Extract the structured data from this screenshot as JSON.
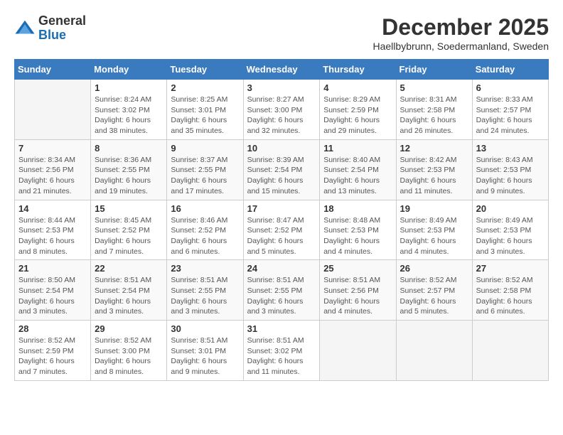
{
  "header": {
    "logo": {
      "general": "General",
      "blue": "Blue"
    },
    "title": "December 2025",
    "location": "Haellbybrunn, Soedermanland, Sweden"
  },
  "calendar": {
    "days_of_week": [
      "Sunday",
      "Monday",
      "Tuesday",
      "Wednesday",
      "Thursday",
      "Friday",
      "Saturday"
    ],
    "weeks": [
      [
        {
          "day": "",
          "detail": ""
        },
        {
          "day": "1",
          "detail": "Sunrise: 8:24 AM\nSunset: 3:02 PM\nDaylight: 6 hours\nand 38 minutes."
        },
        {
          "day": "2",
          "detail": "Sunrise: 8:25 AM\nSunset: 3:01 PM\nDaylight: 6 hours\nand 35 minutes."
        },
        {
          "day": "3",
          "detail": "Sunrise: 8:27 AM\nSunset: 3:00 PM\nDaylight: 6 hours\nand 32 minutes."
        },
        {
          "day": "4",
          "detail": "Sunrise: 8:29 AM\nSunset: 2:59 PM\nDaylight: 6 hours\nand 29 minutes."
        },
        {
          "day": "5",
          "detail": "Sunrise: 8:31 AM\nSunset: 2:58 PM\nDaylight: 6 hours\nand 26 minutes."
        },
        {
          "day": "6",
          "detail": "Sunrise: 8:33 AM\nSunset: 2:57 PM\nDaylight: 6 hours\nand 24 minutes."
        }
      ],
      [
        {
          "day": "7",
          "detail": "Sunrise: 8:34 AM\nSunset: 2:56 PM\nDaylight: 6 hours\nand 21 minutes."
        },
        {
          "day": "8",
          "detail": "Sunrise: 8:36 AM\nSunset: 2:55 PM\nDaylight: 6 hours\nand 19 minutes."
        },
        {
          "day": "9",
          "detail": "Sunrise: 8:37 AM\nSunset: 2:55 PM\nDaylight: 6 hours\nand 17 minutes."
        },
        {
          "day": "10",
          "detail": "Sunrise: 8:39 AM\nSunset: 2:54 PM\nDaylight: 6 hours\nand 15 minutes."
        },
        {
          "day": "11",
          "detail": "Sunrise: 8:40 AM\nSunset: 2:54 PM\nDaylight: 6 hours\nand 13 minutes."
        },
        {
          "day": "12",
          "detail": "Sunrise: 8:42 AM\nSunset: 2:53 PM\nDaylight: 6 hours\nand 11 minutes."
        },
        {
          "day": "13",
          "detail": "Sunrise: 8:43 AM\nSunset: 2:53 PM\nDaylight: 6 hours\nand 9 minutes."
        }
      ],
      [
        {
          "day": "14",
          "detail": "Sunrise: 8:44 AM\nSunset: 2:53 PM\nDaylight: 6 hours\nand 8 minutes."
        },
        {
          "day": "15",
          "detail": "Sunrise: 8:45 AM\nSunset: 2:52 PM\nDaylight: 6 hours\nand 7 minutes."
        },
        {
          "day": "16",
          "detail": "Sunrise: 8:46 AM\nSunset: 2:52 PM\nDaylight: 6 hours\nand 6 minutes."
        },
        {
          "day": "17",
          "detail": "Sunrise: 8:47 AM\nSunset: 2:52 PM\nDaylight: 6 hours\nand 5 minutes."
        },
        {
          "day": "18",
          "detail": "Sunrise: 8:48 AM\nSunset: 2:53 PM\nDaylight: 6 hours\nand 4 minutes."
        },
        {
          "day": "19",
          "detail": "Sunrise: 8:49 AM\nSunset: 2:53 PM\nDaylight: 6 hours\nand 4 minutes."
        },
        {
          "day": "20",
          "detail": "Sunrise: 8:49 AM\nSunset: 2:53 PM\nDaylight: 6 hours\nand 3 minutes."
        }
      ],
      [
        {
          "day": "21",
          "detail": "Sunrise: 8:50 AM\nSunset: 2:54 PM\nDaylight: 6 hours\nand 3 minutes."
        },
        {
          "day": "22",
          "detail": "Sunrise: 8:51 AM\nSunset: 2:54 PM\nDaylight: 6 hours\nand 3 minutes."
        },
        {
          "day": "23",
          "detail": "Sunrise: 8:51 AM\nSunset: 2:55 PM\nDaylight: 6 hours\nand 3 minutes."
        },
        {
          "day": "24",
          "detail": "Sunrise: 8:51 AM\nSunset: 2:55 PM\nDaylight: 6 hours\nand 3 minutes."
        },
        {
          "day": "25",
          "detail": "Sunrise: 8:51 AM\nSunset: 2:56 PM\nDaylight: 6 hours\nand 4 minutes."
        },
        {
          "day": "26",
          "detail": "Sunrise: 8:52 AM\nSunset: 2:57 PM\nDaylight: 6 hours\nand 5 minutes."
        },
        {
          "day": "27",
          "detail": "Sunrise: 8:52 AM\nSunset: 2:58 PM\nDaylight: 6 hours\nand 6 minutes."
        }
      ],
      [
        {
          "day": "28",
          "detail": "Sunrise: 8:52 AM\nSunset: 2:59 PM\nDaylight: 6 hours\nand 7 minutes."
        },
        {
          "day": "29",
          "detail": "Sunrise: 8:52 AM\nSunset: 3:00 PM\nDaylight: 6 hours\nand 8 minutes."
        },
        {
          "day": "30",
          "detail": "Sunrise: 8:51 AM\nSunset: 3:01 PM\nDaylight: 6 hours\nand 9 minutes."
        },
        {
          "day": "31",
          "detail": "Sunrise: 8:51 AM\nSunset: 3:02 PM\nDaylight: 6 hours\nand 11 minutes."
        },
        {
          "day": "",
          "detail": ""
        },
        {
          "day": "",
          "detail": ""
        },
        {
          "day": "",
          "detail": ""
        }
      ]
    ]
  }
}
